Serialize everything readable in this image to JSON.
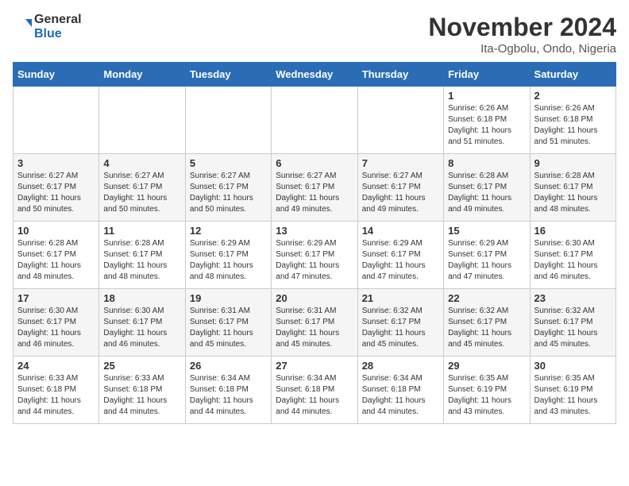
{
  "header": {
    "logo_general": "General",
    "logo_blue": "Blue",
    "title": "November 2024",
    "subtitle": "Ita-Ogbolu, Ondo, Nigeria"
  },
  "weekdays": [
    "Sunday",
    "Monday",
    "Tuesday",
    "Wednesday",
    "Thursday",
    "Friday",
    "Saturday"
  ],
  "weeks": [
    [
      {
        "day": "",
        "info": ""
      },
      {
        "day": "",
        "info": ""
      },
      {
        "day": "",
        "info": ""
      },
      {
        "day": "",
        "info": ""
      },
      {
        "day": "",
        "info": ""
      },
      {
        "day": "1",
        "info": "Sunrise: 6:26 AM\nSunset: 6:18 PM\nDaylight: 11 hours and 51 minutes."
      },
      {
        "day": "2",
        "info": "Sunrise: 6:26 AM\nSunset: 6:18 PM\nDaylight: 11 hours and 51 minutes."
      }
    ],
    [
      {
        "day": "3",
        "info": "Sunrise: 6:27 AM\nSunset: 6:17 PM\nDaylight: 11 hours and 50 minutes."
      },
      {
        "day": "4",
        "info": "Sunrise: 6:27 AM\nSunset: 6:17 PM\nDaylight: 11 hours and 50 minutes."
      },
      {
        "day": "5",
        "info": "Sunrise: 6:27 AM\nSunset: 6:17 PM\nDaylight: 11 hours and 50 minutes."
      },
      {
        "day": "6",
        "info": "Sunrise: 6:27 AM\nSunset: 6:17 PM\nDaylight: 11 hours and 49 minutes."
      },
      {
        "day": "7",
        "info": "Sunrise: 6:27 AM\nSunset: 6:17 PM\nDaylight: 11 hours and 49 minutes."
      },
      {
        "day": "8",
        "info": "Sunrise: 6:28 AM\nSunset: 6:17 PM\nDaylight: 11 hours and 49 minutes."
      },
      {
        "day": "9",
        "info": "Sunrise: 6:28 AM\nSunset: 6:17 PM\nDaylight: 11 hours and 48 minutes."
      }
    ],
    [
      {
        "day": "10",
        "info": "Sunrise: 6:28 AM\nSunset: 6:17 PM\nDaylight: 11 hours and 48 minutes."
      },
      {
        "day": "11",
        "info": "Sunrise: 6:28 AM\nSunset: 6:17 PM\nDaylight: 11 hours and 48 minutes."
      },
      {
        "day": "12",
        "info": "Sunrise: 6:29 AM\nSunset: 6:17 PM\nDaylight: 11 hours and 48 minutes."
      },
      {
        "day": "13",
        "info": "Sunrise: 6:29 AM\nSunset: 6:17 PM\nDaylight: 11 hours and 47 minutes."
      },
      {
        "day": "14",
        "info": "Sunrise: 6:29 AM\nSunset: 6:17 PM\nDaylight: 11 hours and 47 minutes."
      },
      {
        "day": "15",
        "info": "Sunrise: 6:29 AM\nSunset: 6:17 PM\nDaylight: 11 hours and 47 minutes."
      },
      {
        "day": "16",
        "info": "Sunrise: 6:30 AM\nSunset: 6:17 PM\nDaylight: 11 hours and 46 minutes."
      }
    ],
    [
      {
        "day": "17",
        "info": "Sunrise: 6:30 AM\nSunset: 6:17 PM\nDaylight: 11 hours and 46 minutes."
      },
      {
        "day": "18",
        "info": "Sunrise: 6:30 AM\nSunset: 6:17 PM\nDaylight: 11 hours and 46 minutes."
      },
      {
        "day": "19",
        "info": "Sunrise: 6:31 AM\nSunset: 6:17 PM\nDaylight: 11 hours and 45 minutes."
      },
      {
        "day": "20",
        "info": "Sunrise: 6:31 AM\nSunset: 6:17 PM\nDaylight: 11 hours and 45 minutes."
      },
      {
        "day": "21",
        "info": "Sunrise: 6:32 AM\nSunset: 6:17 PM\nDaylight: 11 hours and 45 minutes."
      },
      {
        "day": "22",
        "info": "Sunrise: 6:32 AM\nSunset: 6:17 PM\nDaylight: 11 hours and 45 minutes."
      },
      {
        "day": "23",
        "info": "Sunrise: 6:32 AM\nSunset: 6:17 PM\nDaylight: 11 hours and 45 minutes."
      }
    ],
    [
      {
        "day": "24",
        "info": "Sunrise: 6:33 AM\nSunset: 6:18 PM\nDaylight: 11 hours and 44 minutes."
      },
      {
        "day": "25",
        "info": "Sunrise: 6:33 AM\nSunset: 6:18 PM\nDaylight: 11 hours and 44 minutes."
      },
      {
        "day": "26",
        "info": "Sunrise: 6:34 AM\nSunset: 6:18 PM\nDaylight: 11 hours and 44 minutes."
      },
      {
        "day": "27",
        "info": "Sunrise: 6:34 AM\nSunset: 6:18 PM\nDaylight: 11 hours and 44 minutes."
      },
      {
        "day": "28",
        "info": "Sunrise: 6:34 AM\nSunset: 6:18 PM\nDaylight: 11 hours and 44 minutes."
      },
      {
        "day": "29",
        "info": "Sunrise: 6:35 AM\nSunset: 6:19 PM\nDaylight: 11 hours and 43 minutes."
      },
      {
        "day": "30",
        "info": "Sunrise: 6:35 AM\nSunset: 6:19 PM\nDaylight: 11 hours and 43 minutes."
      }
    ]
  ]
}
